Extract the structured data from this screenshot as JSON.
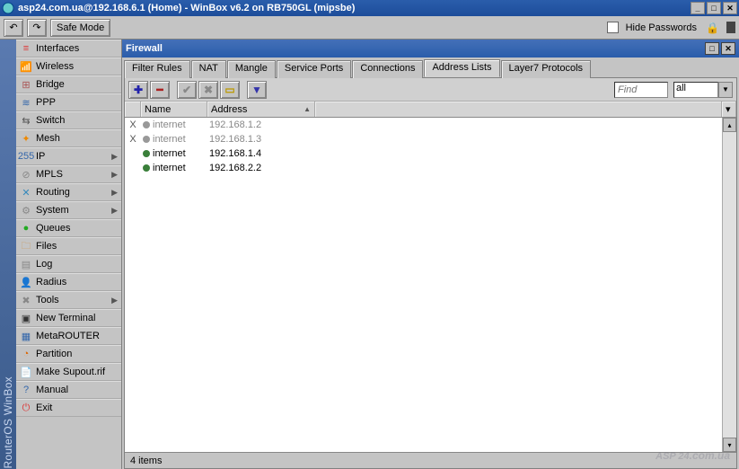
{
  "title": "asp24.com.ua@192.168.6.1 (Home) - WinBox v6.2 on RB750GL (mipsbe)",
  "toolbar": {
    "safe_mode": "Safe Mode",
    "hide_passwords": "Hide Passwords"
  },
  "sidebar_label": "RouterOS WinBox",
  "menu": [
    {
      "icon": "≡",
      "color": "#d33",
      "label": "Interfaces",
      "arrow": false
    },
    {
      "icon": "📶",
      "color": "#555",
      "label": "Wireless",
      "arrow": false
    },
    {
      "icon": "⊞",
      "color": "#a55",
      "label": "Bridge",
      "arrow": false
    },
    {
      "icon": "≋",
      "color": "#36a",
      "label": "PPP",
      "arrow": false
    },
    {
      "icon": "⇆",
      "color": "#555",
      "label": "Switch",
      "arrow": false
    },
    {
      "icon": "✦",
      "color": "#e80",
      "label": "Mesh",
      "arrow": false
    },
    {
      "icon": "255",
      "color": "#36a",
      "label": "IP",
      "arrow": true
    },
    {
      "icon": "⊘",
      "color": "#888",
      "label": "MPLS",
      "arrow": true
    },
    {
      "icon": "✕",
      "color": "#38b",
      "label": "Routing",
      "arrow": true
    },
    {
      "icon": "⚙",
      "color": "#888",
      "label": "System",
      "arrow": true
    },
    {
      "icon": "●",
      "color": "#2a2",
      "label": "Queues",
      "arrow": false
    },
    {
      "icon": "🗀",
      "color": "#c95",
      "label": "Files",
      "arrow": false
    },
    {
      "icon": "▤",
      "color": "#888",
      "label": "Log",
      "arrow": false
    },
    {
      "icon": "👤",
      "color": "#d66",
      "label": "Radius",
      "arrow": false
    },
    {
      "icon": "✖",
      "color": "#888",
      "label": "Tools",
      "arrow": true
    },
    {
      "icon": "▣",
      "color": "#333",
      "label": "New Terminal",
      "arrow": false
    },
    {
      "icon": "▦",
      "color": "#36a",
      "label": "MetaROUTER",
      "arrow": false
    },
    {
      "icon": "◔",
      "color": "#d60",
      "label": "Partition",
      "arrow": false
    },
    {
      "icon": "📄",
      "color": "#c95",
      "label": "Make Supout.rif",
      "arrow": false
    },
    {
      "icon": "?",
      "color": "#36a",
      "label": "Manual",
      "arrow": false
    },
    {
      "icon": "⏻",
      "color": "#d33",
      "label": "Exit",
      "arrow": false
    }
  ],
  "window": {
    "title": "Firewall",
    "tabs": [
      "Filter Rules",
      "NAT",
      "Mangle",
      "Service Ports",
      "Connections",
      "Address Lists",
      "Layer7 Protocols"
    ],
    "active_tab": 5,
    "find_placeholder": "Find",
    "filter_value": "all",
    "columns": [
      "",
      "Name",
      "Address"
    ],
    "rows": [
      {
        "flag": "X",
        "name": "internet",
        "address": "192.168.1.2",
        "disabled": true
      },
      {
        "flag": "X",
        "name": "internet",
        "address": "192.168.1.3",
        "disabled": true
      },
      {
        "flag": "",
        "name": "internet",
        "address": "192.168.1.4",
        "disabled": false
      },
      {
        "flag": "",
        "name": "internet",
        "address": "192.168.2.2",
        "disabled": false
      }
    ],
    "status": "4 items"
  },
  "watermark": "ASP 24",
  "watermark_suffix": ".com.ua"
}
